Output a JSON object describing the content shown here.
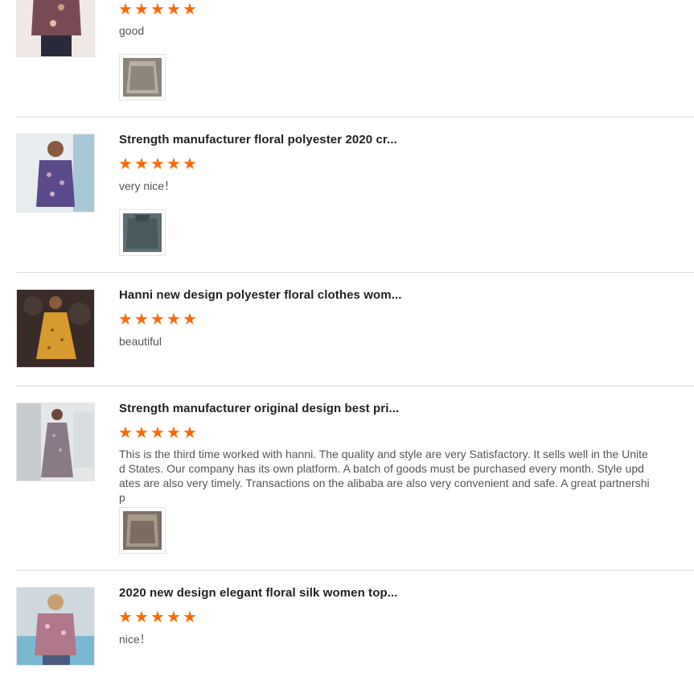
{
  "reviews": [
    {
      "title": "",
      "rating": 5,
      "comment": "good",
      "has_photo": true,
      "colors": {
        "thumb_bg": "#7a4a54",
        "thumb_fg": "#c8a07a",
        "pic_bg": "#8a8578"
      }
    },
    {
      "title": "Strength manufacturer floral polyester 2020 cr...",
      "rating": 5,
      "comment": "very nice！",
      "has_photo": true,
      "colors": {
        "thumb_bg": "#e8edf0",
        "thumb_fg": "#5a4a8a",
        "pic_bg": "#5d6f73"
      }
    },
    {
      "title": "Hanni new design polyester floral clothes wom...",
      "rating": 5,
      "comment": "beautiful",
      "has_photo": false,
      "colors": {
        "thumb_bg": "#3a2a28",
        "thumb_fg": "#d69a2e",
        "pic_bg": "#888"
      }
    },
    {
      "title": "Strength manufacturer original design best pri...",
      "rating": 5,
      "comment": "This is the third time worked with hanni. The quality and style are very Satisfactory. It sells well in the United States. Our company has its own platform. A batch of goods must be purchased every month. Style updates are also very timely. Transactions on the alibaba are also very convenient and safe. A great partnership",
      "has_photo": true,
      "colors": {
        "thumb_bg": "#e4e6e8",
        "thumb_fg": "#8a7a86",
        "pic_bg": "#7b6f66"
      }
    },
    {
      "title": "2020 new design elegant floral silk women top...",
      "rating": 5,
      "comment": "nice！",
      "has_photo": false,
      "colors": {
        "thumb_bg": "#cfd8dc",
        "thumb_fg": "#b0788a",
        "pic_bg": "#888"
      }
    }
  ],
  "star_color": "#ff6a00",
  "star_glyph": "★"
}
